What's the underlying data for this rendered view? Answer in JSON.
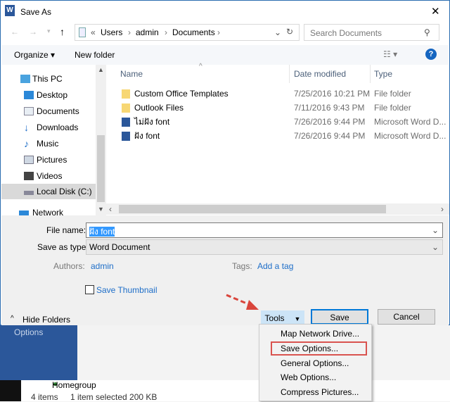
{
  "window": {
    "title": "Save As",
    "close": "✕"
  },
  "address": {
    "prefix": "«",
    "crumbs": [
      "Users",
      "admin",
      "Documents"
    ],
    "search_placeholder": "Search Documents"
  },
  "toolbar": {
    "organize": "Organize ▾",
    "new_folder": "New folder"
  },
  "nav": [
    {
      "label": "This PC",
      "icon": "computer-icon"
    },
    {
      "label": "Desktop",
      "icon": "desktop-icon"
    },
    {
      "label": "Documents",
      "icon": "documents-icon"
    },
    {
      "label": "Downloads",
      "icon": "downloads-icon"
    },
    {
      "label": "Music",
      "icon": "music-icon"
    },
    {
      "label": "Pictures",
      "icon": "pictures-icon"
    },
    {
      "label": "Videos",
      "icon": "videos-icon"
    },
    {
      "label": "Local Disk (C:)",
      "icon": "disk-icon"
    },
    {
      "label": "Network",
      "icon": "network-icon"
    }
  ],
  "columns": {
    "name": "Name",
    "date": "Date modified",
    "type": "Type"
  },
  "files": [
    {
      "name": "Custom Office Templates",
      "date": "7/25/2016 10:21 PM",
      "type": "File folder",
      "icon": "folder"
    },
    {
      "name": "Outlook Files",
      "date": "7/11/2016 9:43 PM",
      "type": "File folder",
      "icon": "folder"
    },
    {
      "name": "ไม่ฝัง font",
      "date": "7/26/2016 9:44 PM",
      "type": "Microsoft Word D...",
      "icon": "word"
    },
    {
      "name": "ฝัง font",
      "date": "7/26/2016 9:44 PM",
      "type": "Microsoft Word D...",
      "icon": "word"
    }
  ],
  "form": {
    "file_name_label": "File name:",
    "file_name": "ฝัง font",
    "type_label": "Save as type:",
    "type": "Word Document",
    "authors_label": "Authors:",
    "authors": "admin",
    "tags_label": "Tags:",
    "tags": "Add a tag",
    "thumbnail": "Save Thumbnail",
    "thumbnail_checked": false
  },
  "buttons": {
    "hide_folders": "Hide Folders",
    "tools": "Tools",
    "save": "Save",
    "cancel": "Cancel"
  },
  "tools_menu": [
    "Map Network Drive...",
    "Save Options...",
    "General Options...",
    "Web Options...",
    "Compress Pictures..."
  ],
  "highlighted_menu_item": "Save Options...",
  "background": {
    "options": "Options",
    "homegroup": "Homegroup",
    "status_items": "4 items",
    "status_selected": "1 item selected  200 KB"
  },
  "colors": {
    "accent": "#2b579a",
    "highlight": "#d9534f",
    "link": "#1e6ec8"
  }
}
